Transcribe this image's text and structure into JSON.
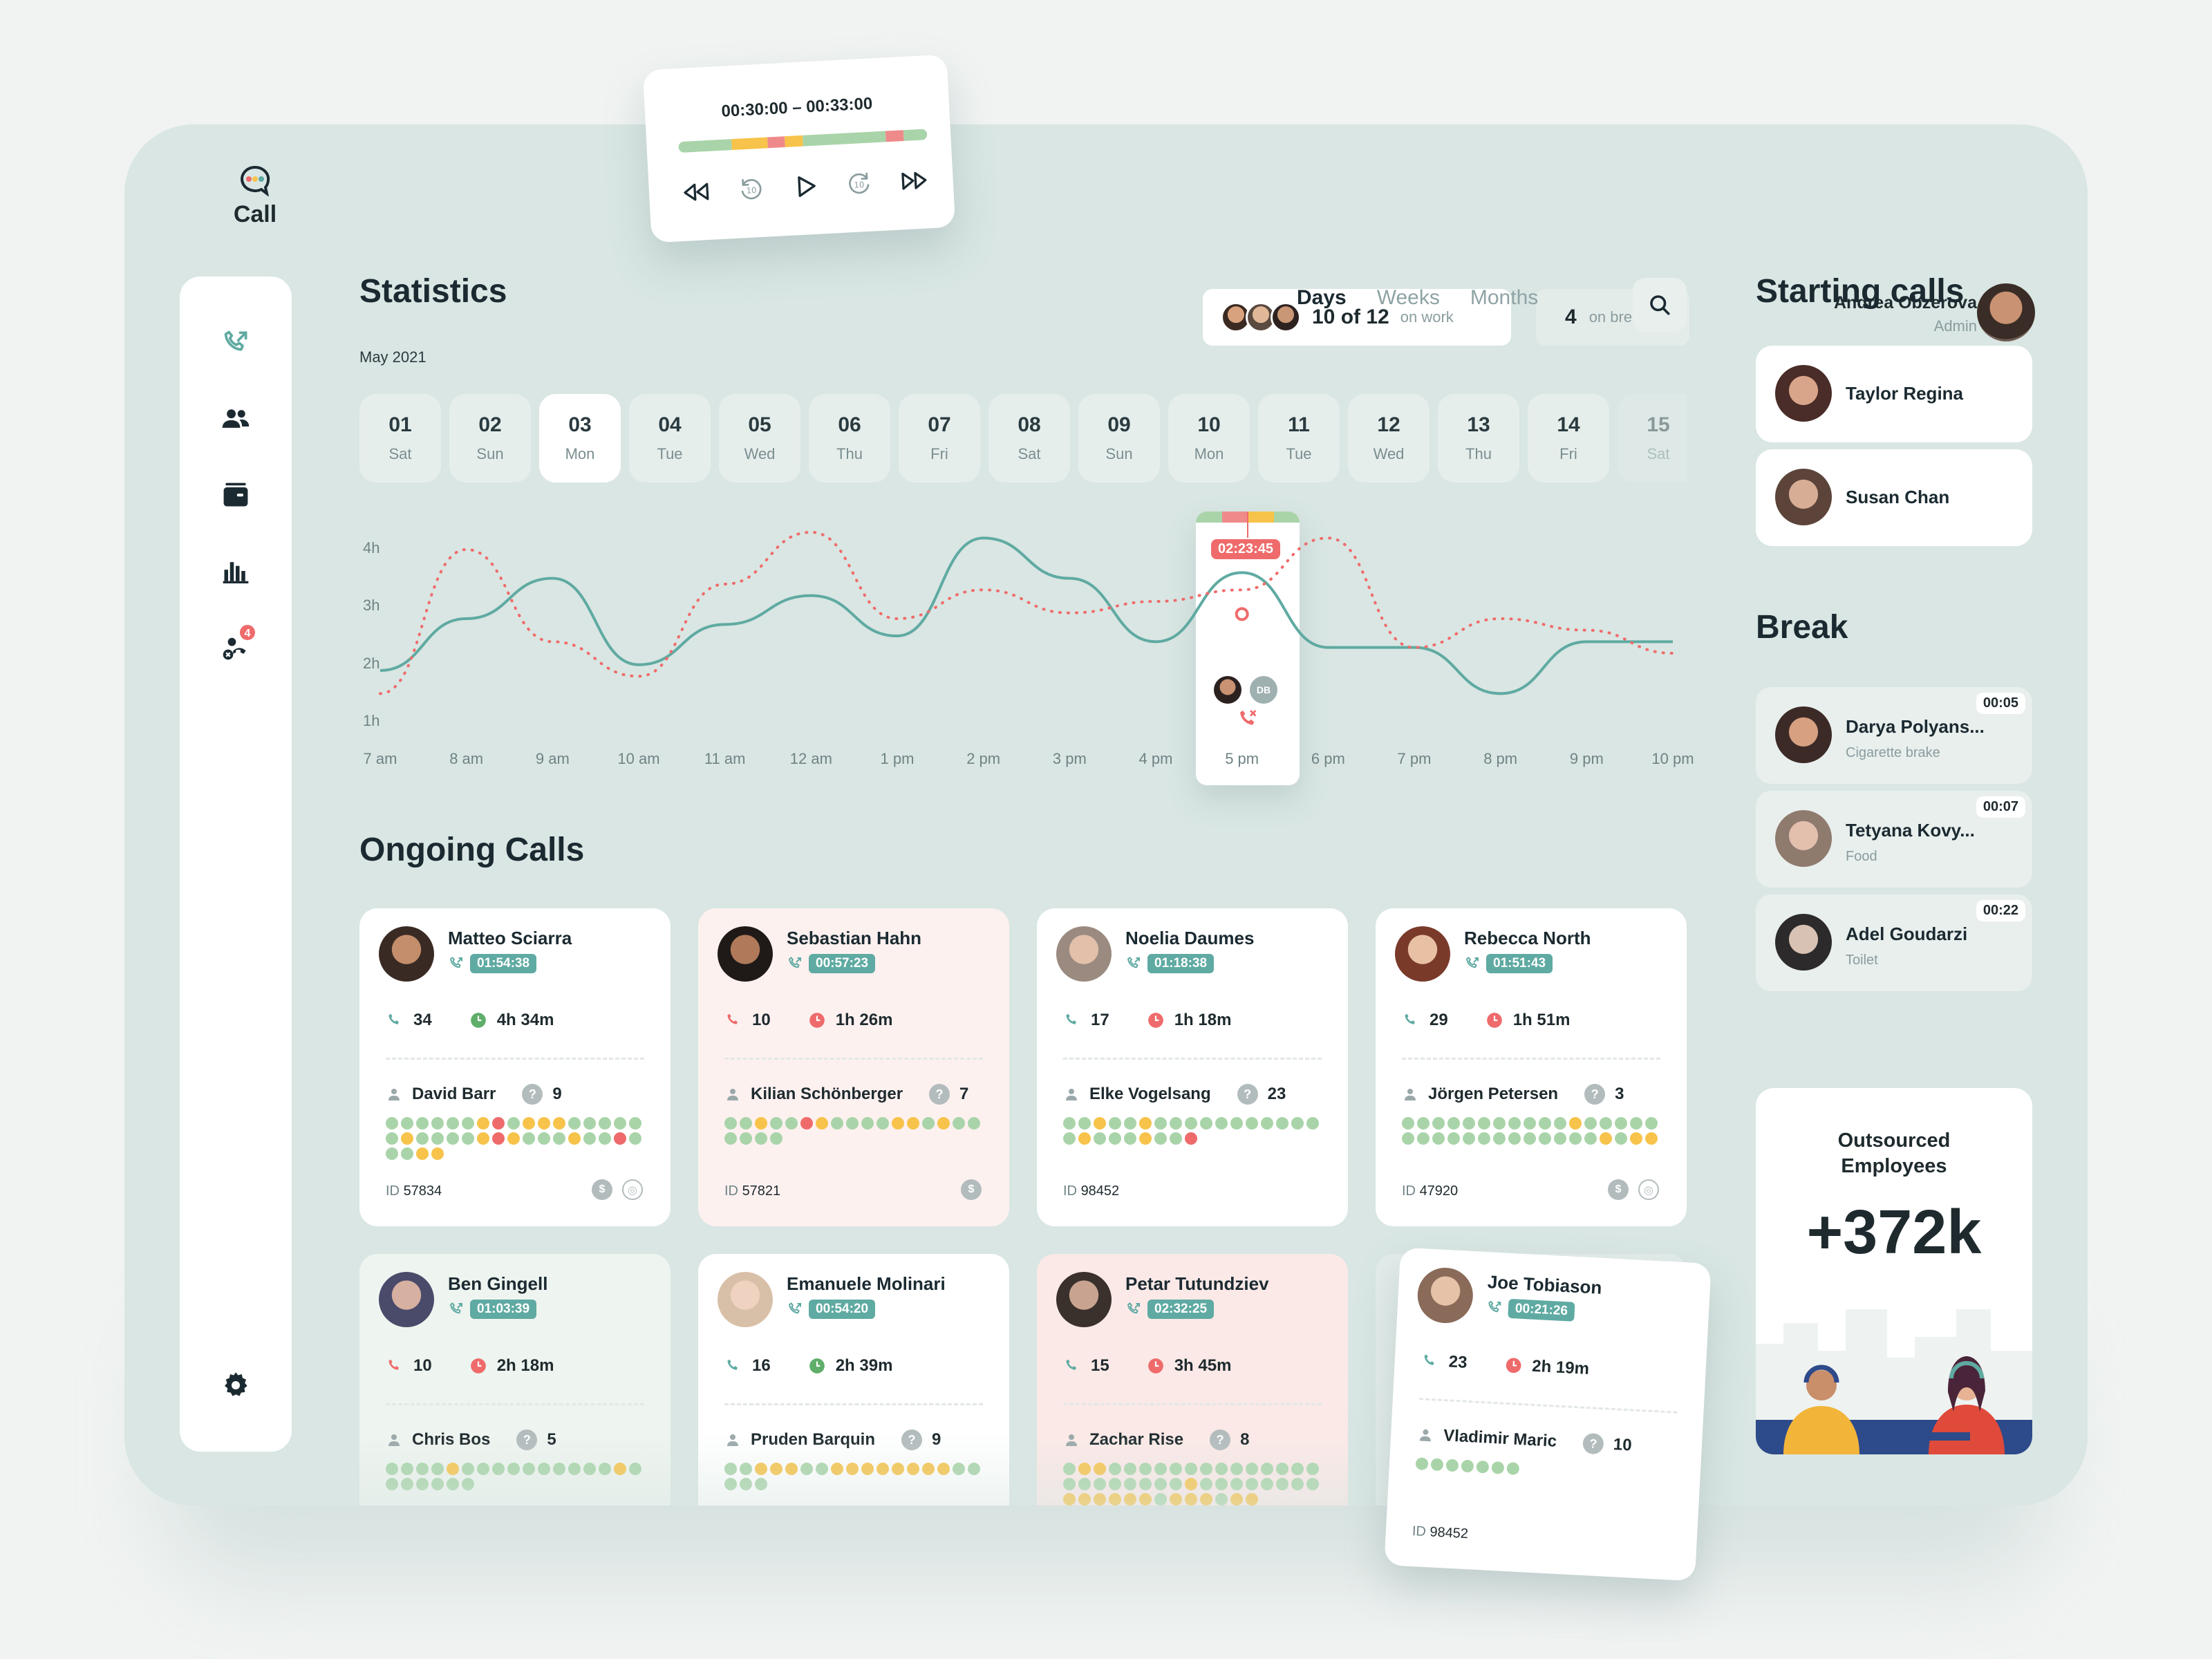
{
  "app": {
    "name": "Call"
  },
  "header": {
    "work_count": "10 of 12",
    "work_label": "on work",
    "break_count": "4",
    "break_label": "on break",
    "user_name": "Andrea Obzerova",
    "user_role": "Admin"
  },
  "player": {
    "range": "00:30:00 – 00:33:00"
  },
  "stats": {
    "title": "Statistics",
    "month": "May 2021",
    "tabs": [
      "Days",
      "Weeks",
      "Months"
    ],
    "days": [
      {
        "n": "01",
        "w": "Sat"
      },
      {
        "n": "02",
        "w": "Sun"
      },
      {
        "n": "03",
        "w": "Mon"
      },
      {
        "n": "04",
        "w": "Tue"
      },
      {
        "n": "05",
        "w": "Wed"
      },
      {
        "n": "06",
        "w": "Thu"
      },
      {
        "n": "07",
        "w": "Fri"
      },
      {
        "n": "08",
        "w": "Sat"
      },
      {
        "n": "09",
        "w": "Sun"
      },
      {
        "n": "10",
        "w": "Mon"
      },
      {
        "n": "11",
        "w": "Tue"
      },
      {
        "n": "12",
        "w": "Wed"
      },
      {
        "n": "13",
        "w": "Thu"
      },
      {
        "n": "14",
        "w": "Fri"
      },
      {
        "n": "15",
        "w": "Sat"
      }
    ],
    "hover_time": "02:23:45",
    "hover_initials": "DB"
  },
  "chart_data": {
    "type": "line",
    "x": [
      "7 am",
      "8 am",
      "9 am",
      "10 am",
      "11 am",
      "12 am",
      "1 pm",
      "2 pm",
      "3 pm",
      "4 pm",
      "5 pm",
      "6 pm",
      "7 pm",
      "8 pm",
      "9 pm",
      "10 pm"
    ],
    "y_ticks": [
      "4h",
      "3h",
      "2h",
      "1h"
    ],
    "ylim": [
      1,
      4
    ],
    "series": [
      {
        "color": "#5faaa2",
        "style": "solid",
        "values": [
          1.6,
          2.5,
          3.2,
          1.7,
          2.4,
          2.9,
          2.2,
          3.9,
          3.2,
          2.1,
          3.3,
          2.0,
          2.0,
          1.2,
          2.1,
          2.1
        ]
      },
      {
        "color": "#ef6b6b",
        "style": "dotted",
        "values": [
          1.2,
          3.7,
          2.1,
          1.5,
          3.1,
          4.0,
          2.5,
          3.0,
          2.6,
          2.8,
          3.0,
          3.9,
          2.0,
          2.5,
          2.3,
          1.9
        ]
      }
    ]
  },
  "ongoing": {
    "title": "Ongoing Calls",
    "id_prefix": "ID",
    "cards": [
      {
        "name": "Matteo Sciarra",
        "time": "01:54:38",
        "calls": "34",
        "dur": "4h 34m",
        "sup": "David Barr",
        "q": "9",
        "id": "57834"
      },
      {
        "name": "Sebastian Hahn",
        "time": "00:57:23",
        "calls": "10",
        "dur": "1h 26m",
        "sup": "Kilian Schönberger",
        "q": "7",
        "id": "57821"
      },
      {
        "name": "Noelia Daumes",
        "time": "01:18:38",
        "calls": "17",
        "dur": "1h 18m",
        "sup": "Elke Vogelsang",
        "q": "23",
        "id": "98452"
      },
      {
        "name": "Rebecca North",
        "time": "01:51:43",
        "calls": "29",
        "dur": "1h 51m",
        "sup": "Jörgen Petersen",
        "q": "3",
        "id": "47920"
      },
      {
        "name": "Ben Gingell",
        "time": "01:03:39",
        "calls": "10",
        "dur": "2h 18m",
        "sup": "Chris Bos",
        "q": "5"
      },
      {
        "name": "Emanuele Molinari",
        "time": "00:54:20",
        "calls": "16",
        "dur": "2h 39m",
        "sup": "Pruden Barquin",
        "q": "9"
      },
      {
        "name": "Petar Tutundziev",
        "time": "02:32:25",
        "calls": "15",
        "dur": "3h 45m",
        "sup": "Zachar Rise",
        "q": "8"
      },
      {
        "name": "Joe Tobiason",
        "time": "00:21:26",
        "calls": "23",
        "dur": "2h 19m",
        "sup": "Vladimir Maric",
        "q": "10",
        "id": "98452"
      }
    ]
  },
  "starting": {
    "title": "Starting calls",
    "people": [
      "Taylor Regina",
      "Susan Chan"
    ]
  },
  "break": {
    "title": "Break",
    "people": [
      {
        "name": "Darya Polyans...",
        "reason": "Cigarette brake",
        "time": "00:05"
      },
      {
        "name": "Tetyana Kovy...",
        "reason": "Food",
        "time": "00:07"
      },
      {
        "name": "Adel Goudarzi",
        "reason": "Toilet",
        "time": "00:22"
      }
    ]
  },
  "outsourced": {
    "title": "Outsourced Employees",
    "value": "+372k"
  },
  "colors": {
    "teal": "#5faaa2",
    "red": "#ef6b6b",
    "yellow": "#f7c34a",
    "green": "#a9d4a9",
    "bg": "#d9e6e3"
  }
}
